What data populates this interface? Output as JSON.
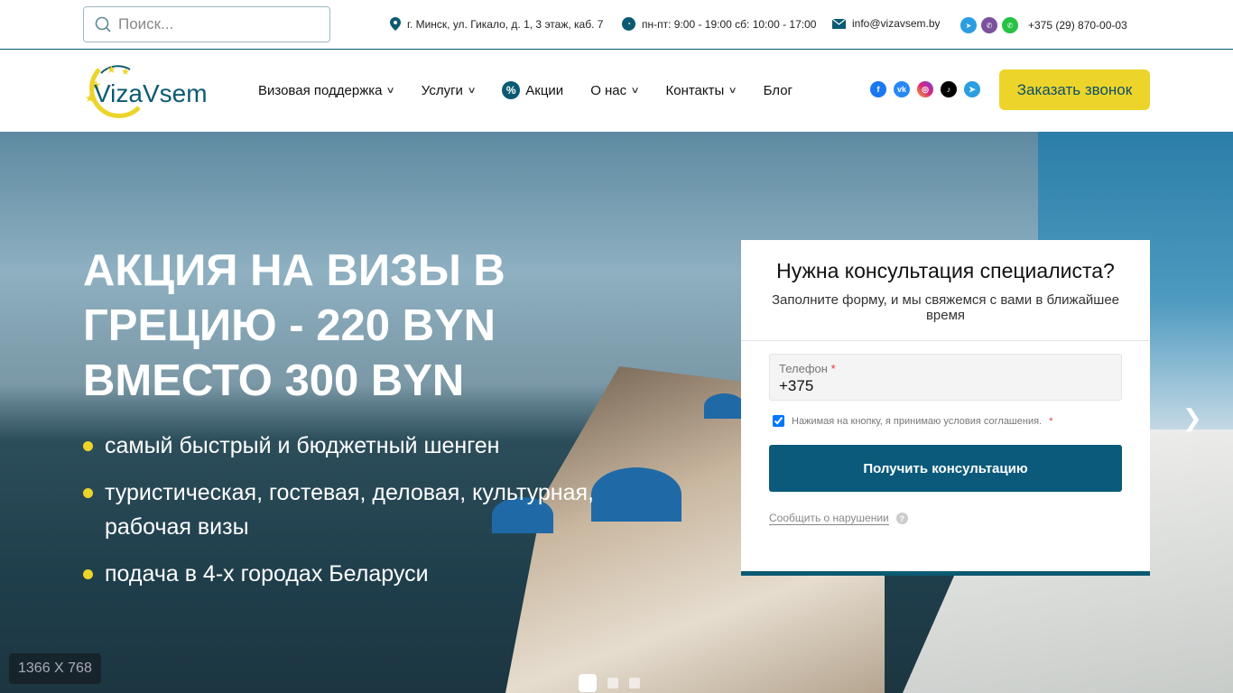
{
  "topbar": {
    "search_placeholder": "Поиск...",
    "address": "г. Минск, ул. Гикало, д. 1, 3 этаж, каб. 7",
    "hours": "пн-пт: 9:00 - 19:00 сб: 10:00 - 17:00",
    "email": "info@vizavsem.by",
    "phone": "+375 (29) 870-00-03",
    "messengers": [
      "telegram-icon",
      "viber-icon",
      "whatsapp-icon"
    ]
  },
  "nav": {
    "logo": "VizaVsem",
    "items": [
      {
        "label": "Визовая поддержка",
        "dropdown": true
      },
      {
        "label": "Услуги",
        "dropdown": true
      },
      {
        "label": "Акции",
        "icon": "percent-badge-icon"
      },
      {
        "label": "О нас",
        "dropdown": true
      },
      {
        "label": "Контакты",
        "dropdown": true
      },
      {
        "label": "Блог"
      }
    ],
    "socials": [
      "facebook-icon",
      "vk-icon",
      "instagram-icon",
      "tiktok-icon",
      "telegram-icon"
    ],
    "call_button": "Заказать звонок"
  },
  "hero": {
    "headline": "АКЦИЯ НА ВИЗЫ В ГРЕЦИЮ - 220 BYN ВМЕСТО 300 BYN",
    "bullets": [
      "самый быстрый и бюджетный шенген",
      "туристическая, гостевая, деловая, культурная, рабочая визы",
      "подача в 4-х городах Беларуси"
    ],
    "slides": 3,
    "active_slide": 1
  },
  "form": {
    "title": "Нужна консультация специалиста?",
    "subtitle": "Заполните форму, и мы свяжемся с вами в ближайшее время",
    "phone_label": "Телефон",
    "required_mark": "*",
    "phone_value": "+375",
    "agree_text": "Нажимая на кнопку, я принимаю условия соглашения.",
    "agree_checked": true,
    "submit": "Получить консультацию",
    "report": "Сообщить о нарушении",
    "help": "?"
  },
  "overlay": {
    "size_label": "1366 X 768"
  },
  "colors": {
    "accent": "#0b5a7b",
    "yellow": "#ecd42a"
  }
}
